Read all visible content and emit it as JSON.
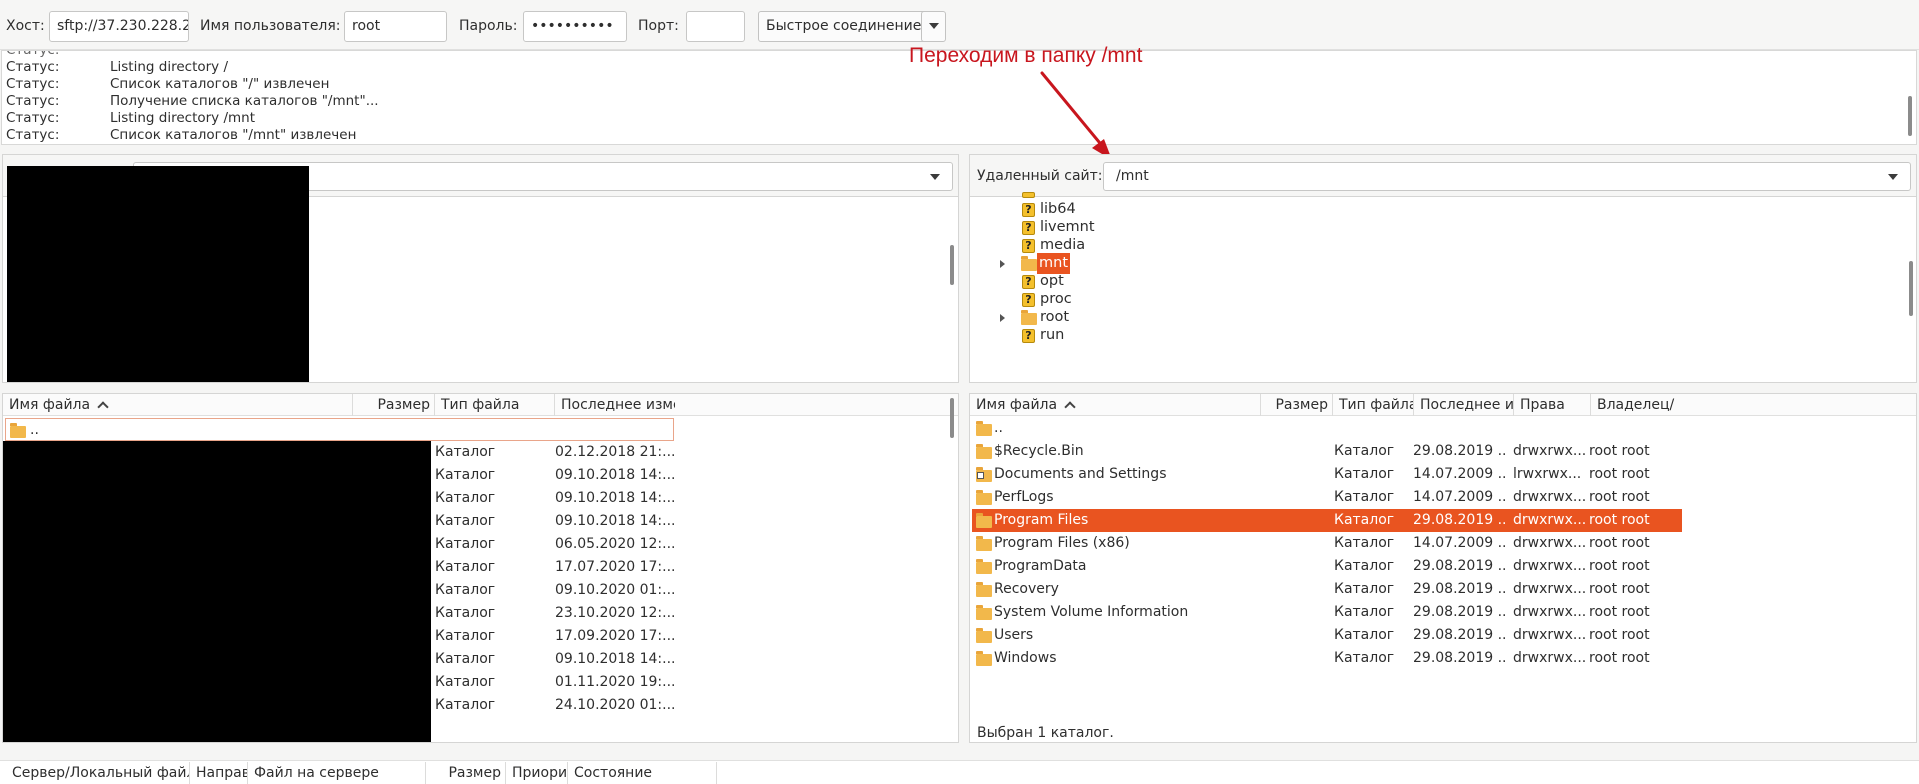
{
  "quickconnect": {
    "host_label": "Хост:",
    "host_value": "sftp://37.230.228.2",
    "user_label": "Имя пользователя:",
    "user_value": "root",
    "pass_label": "Пароль:",
    "pass_value": "••••••••••",
    "port_label": "Порт:",
    "port_value": "",
    "connect_label": "Быстрое соединение"
  },
  "log": [
    {
      "k": "Статус:",
      "v": "Listing directory /"
    },
    {
      "k": "Статус:",
      "v": "Список каталогов \"/\" извлечен"
    },
    {
      "k": "Статус:",
      "v": "Получение списка каталогов \"/mnt\"..."
    },
    {
      "k": "Статус:",
      "v": "Listing directory /mnt"
    },
    {
      "k": "Статус:",
      "v": "Список каталогов \"/mnt\" извлечен"
    }
  ],
  "annotation": "Переходим в папку /mnt",
  "remote": {
    "site_label": "Удаленный сайт:",
    "path": "/mnt",
    "tree": [
      {
        "name": "lib64",
        "icon": "unknown-icon",
        "expander": false,
        "selected": false
      },
      {
        "name": "livemnt",
        "icon": "unknown-icon",
        "expander": false,
        "selected": false
      },
      {
        "name": "media",
        "icon": "unknown-icon",
        "expander": false,
        "selected": false
      },
      {
        "name": "mnt",
        "icon": "folder-icon",
        "expander": true,
        "selected": true
      },
      {
        "name": "opt",
        "icon": "unknown-icon",
        "expander": false,
        "selected": false
      },
      {
        "name": "proc",
        "icon": "unknown-icon",
        "expander": false,
        "selected": false
      },
      {
        "name": "root",
        "icon": "folder-icon",
        "expander": true,
        "selected": false
      },
      {
        "name": "run",
        "icon": "unknown-icon",
        "expander": false,
        "selected": false
      }
    ],
    "columns": [
      "Имя файла",
      "Размер",
      "Тип файла",
      "Последнее из",
      "Права",
      "Владелец/Г"
    ],
    "files": [
      {
        "name": "..",
        "type": "",
        "date": "",
        "perms": "",
        "owner": "",
        "icon": "folder-icon"
      },
      {
        "name": "$Recycle.Bin",
        "type": "Каталог",
        "date": "29.08.2019 ...",
        "perms": "drwxrwx...",
        "owner": "root root",
        "icon": "folder-icon"
      },
      {
        "name": "Documents and Settings",
        "type": "Каталог",
        "date": "14.07.2009 ...",
        "perms": "lrwxrwx...",
        "owner": "root root",
        "icon": "folder-link-icon"
      },
      {
        "name": "PerfLogs",
        "type": "Каталог",
        "date": "14.07.2009 ...",
        "perms": "drwxrwx...",
        "owner": "root root",
        "icon": "folder-icon"
      },
      {
        "name": "Program Files",
        "type": "Каталог",
        "date": "29.08.2019 ...",
        "perms": "drwxrwx...",
        "owner": "root root",
        "icon": "folder-icon",
        "selected": true
      },
      {
        "name": "Program Files (x86)",
        "type": "Каталог",
        "date": "14.07.2009 ...",
        "perms": "drwxrwx...",
        "owner": "root root",
        "icon": "folder-icon"
      },
      {
        "name": "ProgramData",
        "type": "Каталог",
        "date": "29.08.2019 ...",
        "perms": "drwxrwx...",
        "owner": "root root",
        "icon": "folder-icon"
      },
      {
        "name": "Recovery",
        "type": "Каталог",
        "date": "29.08.2019 ...",
        "perms": "drwxrwx...",
        "owner": "root root",
        "icon": "folder-icon"
      },
      {
        "name": "System Volume Information",
        "type": "Каталог",
        "date": "29.08.2019 ...",
        "perms": "drwxrwx...",
        "owner": "root root",
        "icon": "folder-icon"
      },
      {
        "name": "Users",
        "type": "Каталог",
        "date": "29.08.2019 ...",
        "perms": "drwxrwx...",
        "owner": "root root",
        "icon": "folder-icon"
      },
      {
        "name": "Windows",
        "type": "Каталог",
        "date": "29.08.2019 ...",
        "perms": "drwxrwx...",
        "owner": "root root",
        "icon": "folder-icon"
      }
    ],
    "status": "Выбран 1 каталог."
  },
  "local": {
    "columns": [
      "Имя файла",
      "Размер",
      "Тип файла",
      "Последнее изме"
    ],
    "parent_row": "..",
    "files": [
      {
        "type": "Каталог",
        "date": "02.12.2018 21:..."
      },
      {
        "type": "Каталог",
        "date": "09.10.2018 14:..."
      },
      {
        "type": "Каталог",
        "date": "09.10.2018 14:..."
      },
      {
        "type": "Каталог",
        "date": "09.10.2018 14:..."
      },
      {
        "type": "Каталог",
        "date": "06.05.2020 12:..."
      },
      {
        "type": "Каталог",
        "date": "17.07.2020 17:..."
      },
      {
        "type": "Каталог",
        "date": "09.10.2020 01:..."
      },
      {
        "type": "Каталог",
        "date": "23.10.2020 12:..."
      },
      {
        "type": "Каталог",
        "date": "17.09.2020 17:..."
      },
      {
        "type": "Каталог",
        "date": "09.10.2018 14:..."
      },
      {
        "type": "Каталог",
        "date": "01.11.2020 19:..."
      },
      {
        "type": "Каталог",
        "date": "24.10.2020 01:..."
      }
    ]
  },
  "queue": {
    "columns": [
      "Сервер/Локальный файл",
      "Направ",
      "Файл на сервере",
      "Размер",
      "Приори",
      "Состояние"
    ]
  },
  "colors": {
    "accent": "#e95420",
    "annotation": "#c8161e"
  }
}
